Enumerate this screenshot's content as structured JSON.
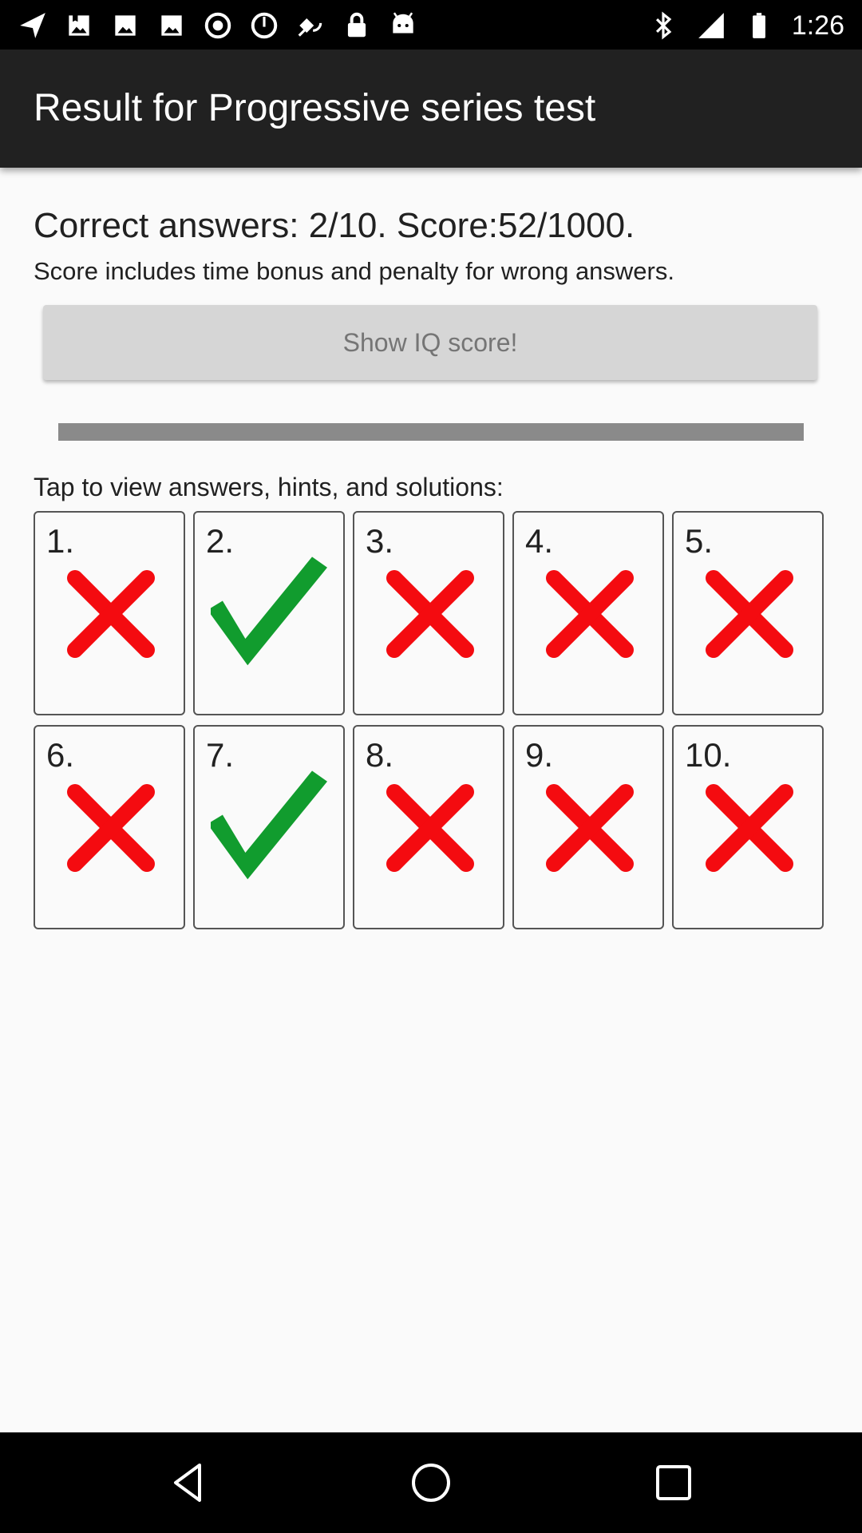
{
  "status_bar": {
    "time": "1:26",
    "icons_left": [
      "navigation-arrow-icon",
      "photo-icon",
      "photo-icon",
      "photo-icon",
      "radio-icon",
      "radio-icon",
      "fake-gps-icon",
      "lock-icon",
      "android-icon"
    ],
    "icons_right": [
      "bluetooth-icon",
      "signal-icon",
      "battery-icon"
    ]
  },
  "app_bar": {
    "title": "Result for Progressive series test"
  },
  "summary": {
    "result_text": "Correct answers: 2/10. Score:52/1000.",
    "note_text": "Score includes time bonus and penalty for wrong answers."
  },
  "iq_button": {
    "label": "Show IQ score!"
  },
  "progress": {
    "value_fraction": 1.0,
    "color": "#8a8a8a"
  },
  "answers": {
    "label": "Tap to view answers, hints, and solutions:",
    "items": [
      {
        "number": "1.",
        "correct": false
      },
      {
        "number": "2.",
        "correct": true
      },
      {
        "number": "3.",
        "correct": false
      },
      {
        "number": "4.",
        "correct": false
      },
      {
        "number": "5.",
        "correct": false
      },
      {
        "number": "6.",
        "correct": false
      },
      {
        "number": "7.",
        "correct": true
      },
      {
        "number": "8.",
        "correct": false
      },
      {
        "number": "9.",
        "correct": false
      },
      {
        "number": "10.",
        "correct": false
      }
    ]
  },
  "colors": {
    "correct": "#119c2e",
    "wrong": "#f40b10",
    "app_bar": "#212121"
  },
  "nav_bar": {
    "icons": [
      "back-icon",
      "home-icon",
      "recents-icon"
    ]
  }
}
